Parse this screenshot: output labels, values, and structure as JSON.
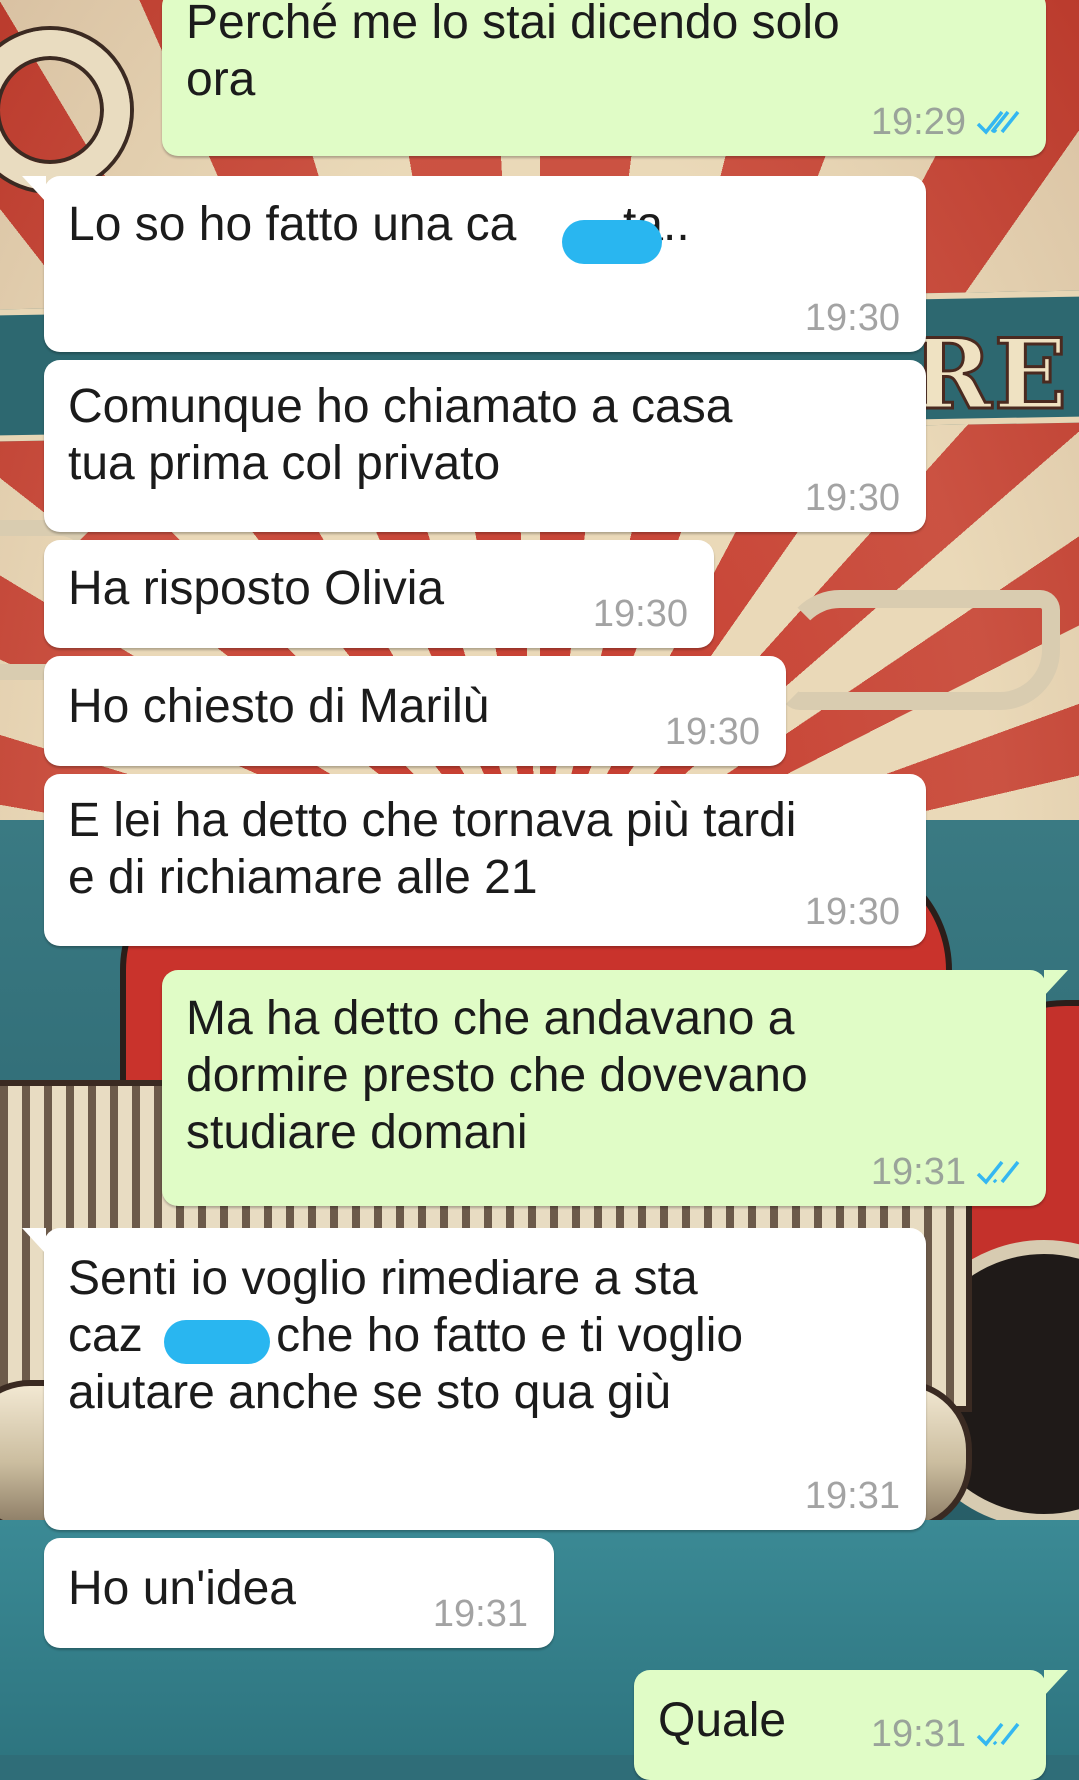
{
  "colors": {
    "incoming_bubble": "#ffffff",
    "outgoing_bubble": "#e0fcc6",
    "read_ticks": "#34b7f1",
    "redaction": "#29b6f0"
  },
  "messages": [
    {
      "direction": "out",
      "text": "Perché me lo stai dicendo solo\nora",
      "time": "19:29",
      "status_icon": "double-check-read-icon"
    },
    {
      "direction": "in",
      "text": "Lo so ho fatto una ca        ta..",
      "time": "19:30",
      "redacted": true
    },
    {
      "direction": "in",
      "text": "Comunque ho chiamato a casa\ntua prima col privato",
      "time": "19:30"
    },
    {
      "direction": "in",
      "text": "Ha risposto Olivia",
      "time": "19:30"
    },
    {
      "direction": "in",
      "text": "Ho chiesto di Marilù",
      "time": "19:30"
    },
    {
      "direction": "in",
      "text": "E lei ha detto che tornava più tardi\ne di richiamare alle 21",
      "time": "19:30"
    },
    {
      "direction": "out",
      "text": "Ma ha detto che andavano a\ndormire presto che dovevano\nstudiare domani",
      "time": "19:31",
      "status_icon": "double-check-read-icon"
    },
    {
      "direction": "in",
      "text": "Senti io voglio rimediare a sta\ncaz       a che ho fatto e ti voglio\naiutare anche se sto qua giù",
      "time": "19:31",
      "redacted": true
    },
    {
      "direction": "in",
      "text": "Ho un'idea",
      "time": "19:31"
    },
    {
      "direction": "out",
      "text": "Quale",
      "time": "19:31",
      "status_icon": "double-check-read-icon"
    }
  ]
}
